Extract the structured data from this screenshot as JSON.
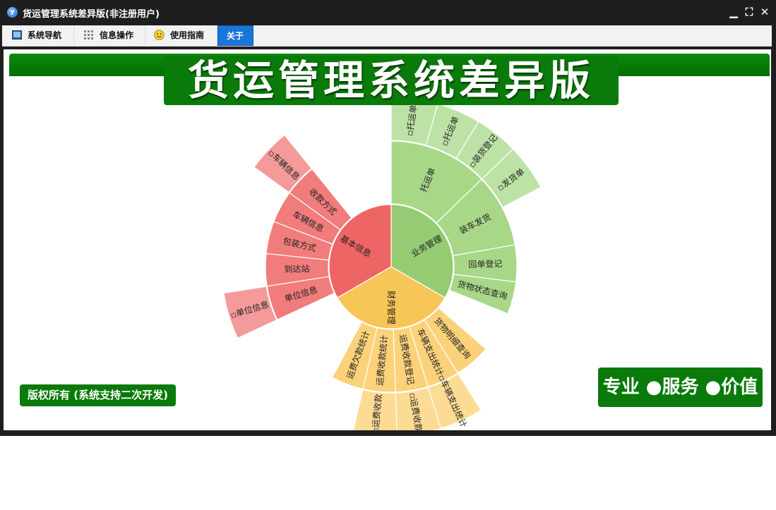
{
  "window": {
    "title": "货运管理系统差异版(非注册用户)",
    "controls": {
      "minimize": "▁",
      "restore": "⛶",
      "close": "✕"
    }
  },
  "menu": [
    {
      "label": "系统导航",
      "icon": "monitor-icon"
    },
    {
      "label": "信息操作",
      "icon": "grid-icon"
    },
    {
      "label": "使用指南",
      "icon": "smiley-icon"
    },
    {
      "label": "关于",
      "active": true
    }
  ],
  "banner": {
    "title": "货运管理系统差异版"
  },
  "footer": {
    "copyright": "版权所有 (系统支持二次开发)",
    "slogan": "专业 ●服务 ●价值"
  },
  "colors": {
    "inner": {
      "业务管理": "#95cb72",
      "财务管理": "#f8c656",
      "基本信息": "#ee6566"
    },
    "middle": {
      "业务管理": "#a8d788",
      "财务管理": "#fbd27a",
      "基本信息": "#f07c7c"
    },
    "outer": {
      "业务管理": "#bde2a5",
      "财务管理": "#fcdc94",
      "基本信息": "#f49a9a"
    },
    "green_bar": "#0a7a0a",
    "active_tab": "#1b75d8"
  },
  "chart_data": {
    "type": "sunburst",
    "rings": {
      "inner": [
        {
          "name": "业务管理",
          "start": 0,
          "end": 120
        },
        {
          "name": "财务管理",
          "start": 120,
          "end": 240
        },
        {
          "name": "基本信息",
          "start": 240,
          "end": 360
        }
      ],
      "middle": [
        {
          "name": "托运单",
          "parent": "业务管理",
          "start": 0,
          "end": 46
        },
        {
          "name": "装车发货",
          "parent": "业务管理",
          "start": 46,
          "end": 80
        },
        {
          "name": "回单登记",
          "parent": "业务管理",
          "start": 80,
          "end": 97
        },
        {
          "name": "货物状态查询",
          "parent": "业务管理",
          "start": 97,
          "end": 112
        },
        {
          "name": "货物明细查询",
          "parent": "财务管理",
          "start": 131,
          "end": 148
        },
        {
          "name": "车辆支出统计",
          "parent": "财务管理",
          "start": 148,
          "end": 163
        },
        {
          "name": "运费收款登记",
          "parent": "财务管理",
          "start": 163,
          "end": 178
        },
        {
          "name": "运费收款统计",
          "parent": "财务管理",
          "start": 178,
          "end": 193
        },
        {
          "name": "运费欠款统计",
          "parent": "财务管理",
          "start": 193,
          "end": 208
        },
        {
          "name": "单位信息",
          "parent": "基本信息",
          "start": 245,
          "end": 261
        },
        {
          "name": "到达站",
          "parent": "基本信息",
          "start": 261,
          "end": 276
        },
        {
          "name": "包装方式",
          "parent": "基本信息",
          "start": 276,
          "end": 291
        },
        {
          "name": "车辆信息",
          "parent": "基本信息",
          "start": 291,
          "end": 306
        },
        {
          "name": "收款方式",
          "parent": "基本信息",
          "start": 306,
          "end": 321
        }
      ],
      "outer": [
        {
          "name": "▫托运单",
          "parent": "托运单",
          "start": 0,
          "end": 16
        },
        {
          "name": "▫托运单",
          "parent": "托运单",
          "start": 16,
          "end": 31
        },
        {
          "name": "▫装货登记",
          "parent": "装车发货",
          "start": 31,
          "end": 46
        },
        {
          "name": "▫发货单",
          "parent": "装车发货",
          "start": 46,
          "end": 62
        },
        {
          "name": "▫车辆支出统计",
          "parent": "车辆支出统计",
          "start": 148,
          "end": 163
        },
        {
          "name": "▫运费收款",
          "parent": "运费收款登记",
          "start": 163,
          "end": 178
        },
        {
          "name": "▫运费收款",
          "parent": "运费收款统计",
          "start": 178,
          "end": 193
        },
        {
          "name": "▫单位信息",
          "parent": "单位信息",
          "start": 245,
          "end": 261
        },
        {
          "name": "▫车辆信息",
          "parent": "车辆信息",
          "start": 306,
          "end": 321
        }
      ]
    }
  }
}
